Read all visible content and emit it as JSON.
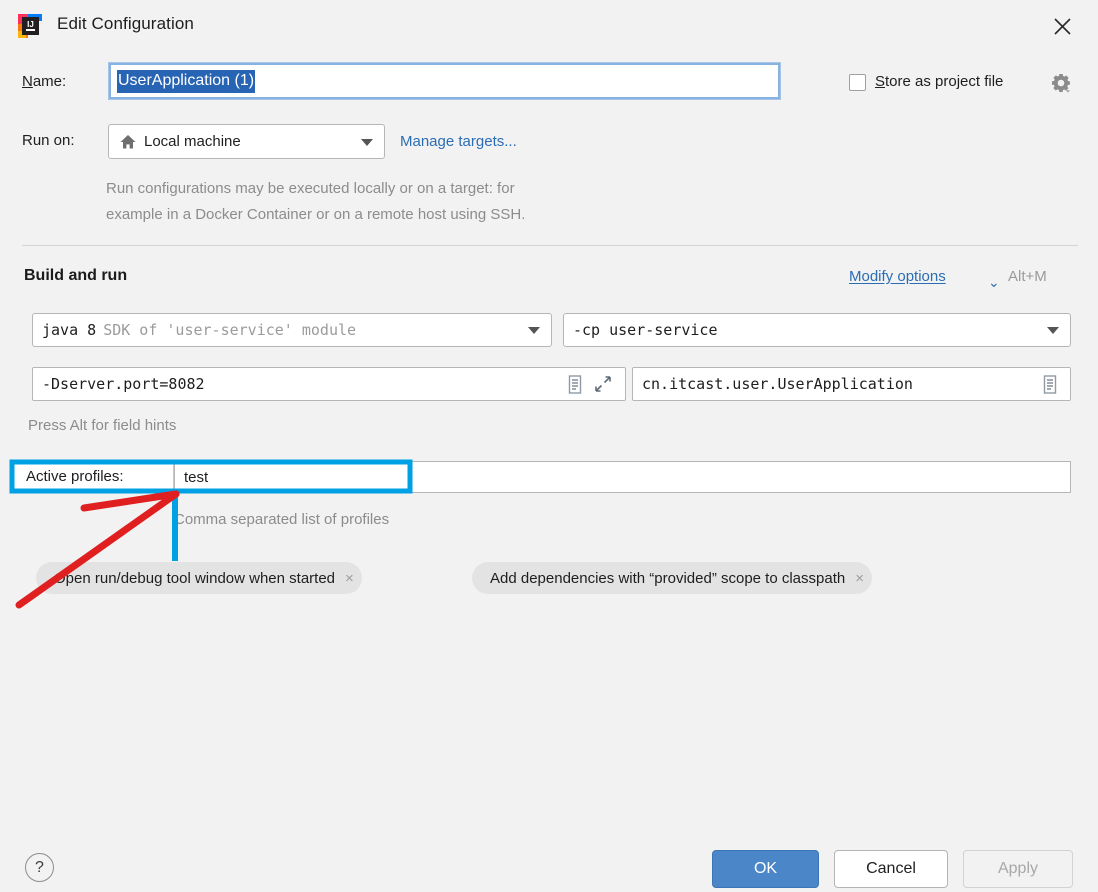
{
  "window": {
    "title": "Edit Configuration",
    "app_icon": "intellij-idea-icon",
    "close_icon": "close-icon"
  },
  "name_row": {
    "label": "Name:",
    "label_mnemonic": "N",
    "value": "UserApplication (1)",
    "selected": true,
    "store_as_project_file": {
      "label": "Store as project file",
      "label_mnemonic": "S",
      "checked": false,
      "gear_icon": "gear-icon"
    }
  },
  "run_on_row": {
    "label": "Run on:",
    "target_icon": "home-icon",
    "target_value": "Local machine",
    "manage_targets_link": "Manage targets...",
    "hint_line1": "Run configurations may be executed locally or on a target: for",
    "hint_line2": "example in a Docker Container or on a remote host using SSH."
  },
  "build_and_run": {
    "section_title": "Build and run",
    "modify_options_link": "Modify options",
    "modify_options_caret": "⌄",
    "modify_options_shortcut": "Alt+M",
    "jdk": {
      "value": "java 8",
      "detail": "SDK of 'user-service' module"
    },
    "classpath": {
      "value": "-cp user-service"
    },
    "vm_options": {
      "value": "-Dserver.port=8082",
      "icons": [
        "document-icon",
        "expand-icon"
      ]
    },
    "main_class": {
      "value": "cn.itcast.user.UserApplication",
      "icons": [
        "document-icon"
      ]
    },
    "field_hints": "Press Alt for field hints"
  },
  "active_profiles": {
    "label": "Active profiles:",
    "value": "test",
    "hint": "Comma separated list of profiles"
  },
  "option_chips": [
    {
      "label": "Open run/debug tool window when started",
      "remove_icon": "close-icon",
      "remove_glyph": "×"
    },
    {
      "label": "Add dependencies with “provided” scope to classpath",
      "remove_icon": "close-icon",
      "remove_glyph": "×"
    }
  ],
  "footer": {
    "help_label": "?",
    "ok_label": "OK",
    "cancel_label": "Cancel",
    "apply_label": "Apply",
    "apply_enabled": false
  },
  "annotations": {
    "highlight_color": "#00a0e4",
    "arrow_color": "#e02020"
  }
}
